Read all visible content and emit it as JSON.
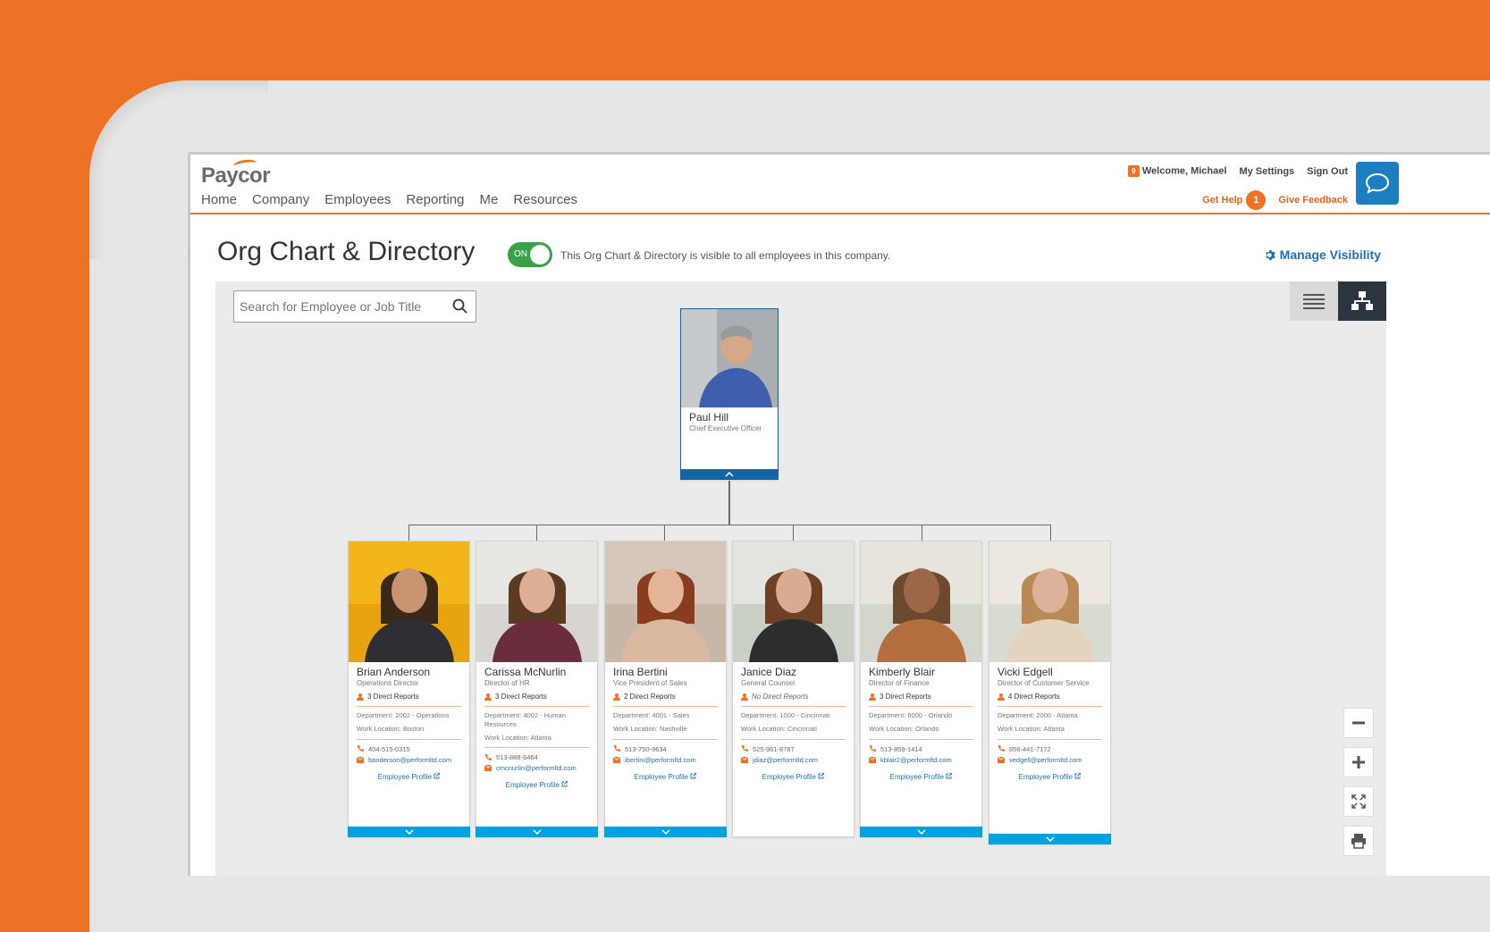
{
  "header": {
    "logo": "Paycor",
    "nav": [
      "Home",
      "Company",
      "Employees",
      "Reporting",
      "Me",
      "Resources"
    ],
    "notification_count": "9",
    "welcome": "Welcome, Michael",
    "my_settings": "My Settings",
    "sign_out": "Sign Out",
    "get_help": "Get Help",
    "help_count": "1",
    "give_feedback": "Give Feedback"
  },
  "page": {
    "title": "Org Chart & Directory",
    "toggle_label": "ON",
    "visibility_text": "This Org Chart & Directory is visible to all employees in this company.",
    "manage_visibility": "Manage Visibility"
  },
  "search": {
    "placeholder": "Search for Employee or Job Title"
  },
  "ceo": {
    "name": "Paul Hill",
    "title": "Chief Executive Officer"
  },
  "employees": [
    {
      "name": "Brian Anderson",
      "title": "Operations Director",
      "reports": "3 Direct Reports",
      "department": "Department: 2002 - Operations",
      "location": "Work Location: Boston",
      "phone": "404-515-0315",
      "email": "banderson@performltd.com",
      "profile": "Employee Profile"
    },
    {
      "name": "Carissa McNurlin",
      "title": "Director of HR",
      "reports": "3 Direct Reports",
      "department": "Department: 4002 - Human Resources",
      "location": "Work Location: Atlanta",
      "phone": "513-888-6464",
      "email": "cmcnurlin@performltd.com",
      "profile": "Employee Profile"
    },
    {
      "name": "Irina Bertini",
      "title": "Vice President of Sales",
      "reports": "2 Direct Reports",
      "department": "Department: 4001 - Sales",
      "location": "Work Location: Nashville",
      "phone": "513-750-9634",
      "email": "ibertini@performltd.com",
      "profile": "Employee Profile"
    },
    {
      "name": "Janice Diaz",
      "title": "General Counsel",
      "reports": "No Direct Reports",
      "department": "Department: 1000 - Cincinnati",
      "location": "Work Location: Cincinnati",
      "phone": "525-961-8787",
      "email": "jdiaz@performltd.com",
      "profile": "Employee Profile"
    },
    {
      "name": "Kimberly Blair",
      "title": "Director of Finance",
      "reports": "3 Direct Reports",
      "department": "Department: 6000 - Orlando",
      "location": "Work Location: Orlando",
      "phone": "513-859-1414",
      "email": "kblair2@performltd.com",
      "profile": "Employee Profile"
    },
    {
      "name": "Vicki Edgell",
      "title": "Director of Customer Service",
      "reports": "4 Direct Reports",
      "department": "Department: 2000 - Atlanta",
      "location": "Work Location: Atlanta",
      "phone": "856-441-7172",
      "email": "vedgell@performltd.com",
      "profile": "Employee Profile"
    }
  ],
  "colors": {
    "brand_orange": "#ee7225",
    "link_blue": "#1f6fb6",
    "toggle_green": "#3aa14a",
    "expand_bar": "#00a3e0",
    "ceo_bar": "#1265a0"
  },
  "icons": [
    "notification-icon",
    "chat-icon",
    "gear-icon",
    "search-icon",
    "list-view-icon",
    "tree-view-icon",
    "person-icon",
    "phone-icon",
    "mail-icon",
    "external-link-icon",
    "chevron-down-icon",
    "chevron-up-icon",
    "zoom-out-icon",
    "zoom-in-icon",
    "fit-screen-icon",
    "print-icon"
  ]
}
